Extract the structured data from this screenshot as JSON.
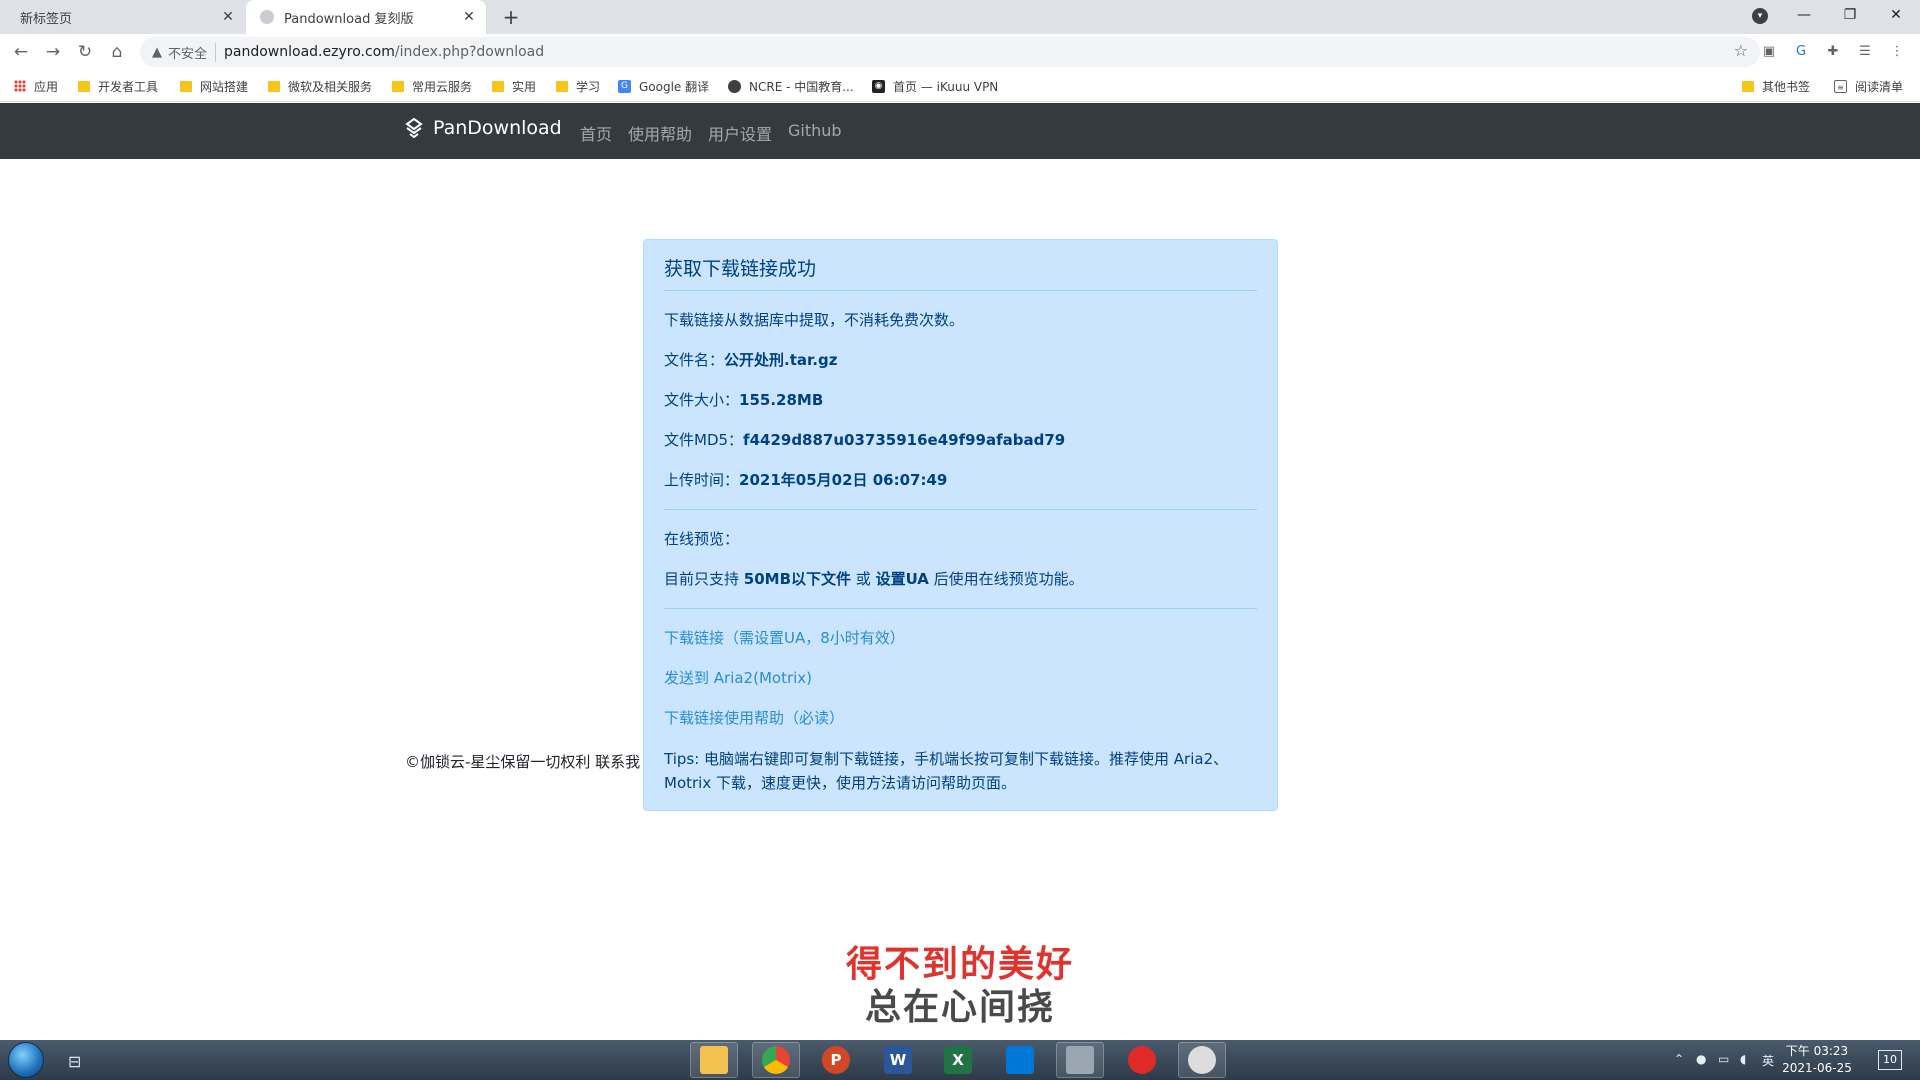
{
  "browser": {
    "tabs": [
      {
        "title": "新标签页",
        "active": false
      },
      {
        "title": "Pandownload 复刻版",
        "active": true
      }
    ],
    "new_tab_label": "+",
    "address": {
      "security_label": "不安全",
      "url_host": "pandownload.ezyro.com",
      "url_path": "/index.php?download"
    },
    "bookmarks": [
      {
        "label": "应用",
        "icon": "apps-grid-icon"
      },
      {
        "label": "开发者工具",
        "icon": "folder-icon"
      },
      {
        "label": "网站搭建",
        "icon": "folder-icon"
      },
      {
        "label": "微软及相关服务",
        "icon": "folder-icon"
      },
      {
        "label": "常用云服务",
        "icon": "folder-icon"
      },
      {
        "label": "实用",
        "icon": "folder-icon"
      },
      {
        "label": "学习",
        "icon": "folder-icon"
      },
      {
        "label": "Google 翻译",
        "icon": "google-translate-icon"
      },
      {
        "label": "NCRE - 中国教育...",
        "icon": "globe-icon"
      },
      {
        "label": "首页 — iKuuu VPN",
        "icon": "cat-icon"
      }
    ],
    "bookmarks_right": [
      {
        "label": "其他书签",
        "icon": "folder-icon"
      },
      {
        "label": "阅读清单",
        "icon": "reading-list-icon"
      }
    ]
  },
  "site": {
    "brand": "PanDownload",
    "nav": [
      "首页",
      "使用帮助",
      "用户设置",
      "Github"
    ],
    "footer": "©伽锁云-星尘保留一切权利 联系我"
  },
  "card": {
    "title": "获取下载链接成功",
    "note": "下载链接从数据库中提取，不消耗免费次数。",
    "filename_label": "文件名：",
    "filename": "公开处刑.tar.gz",
    "size_label": "文件大小：",
    "size": "155.28MB",
    "md5_label": "文件MD5：",
    "md5": "f4429d887u03735916e49f99afabad79",
    "upload_label": "上传时间：",
    "upload_time": "2021年05月02日 06:07:49",
    "preview_title": "在线预览：",
    "preview_prefix": "目前只支持 ",
    "preview_bold1": "50MB以下文件",
    "preview_mid": " 或 ",
    "preview_bold2": "设置UA",
    "preview_suffix": " 后使用在线预览功能。",
    "link_download": "下载链接（需设置UA，8小时有效）",
    "link_aria2": "发送到 Aria2(Motrix)",
    "link_help": "下载链接使用帮助（必读）",
    "tips": "Tips: 电脑端右键即可复制下载链接，手机端长按可复制下载链接。推荐使用 Aria2、Motrix 下载，速度更快，使用方法请访问帮助页面。"
  },
  "lyrics": {
    "line1": "得不到的美好",
    "line2": "总在心间挠"
  },
  "taskbar": {
    "time": "下午 03:23",
    "date": "2021-06-25",
    "ime": "英",
    "notifications": "10",
    "apps": [
      {
        "name": "file-explorer",
        "label": "",
        "color": "#f2c14e"
      },
      {
        "name": "chrome",
        "label": "",
        "color": "#34a853"
      },
      {
        "name": "powerpoint",
        "label": "P",
        "color": "#d24726"
      },
      {
        "name": "word",
        "label": "W",
        "color": "#2b579a"
      },
      {
        "name": "excel",
        "label": "X",
        "color": "#217346"
      },
      {
        "name": "vscode",
        "label": "",
        "color": "#0078d7"
      },
      {
        "name": "monitor",
        "label": "",
        "color": "#9aa7b3"
      },
      {
        "name": "netease-music",
        "label": "",
        "color": "#e02a2a"
      },
      {
        "name": "panda-app",
        "label": "",
        "color": "#dddddd"
      }
    ]
  }
}
